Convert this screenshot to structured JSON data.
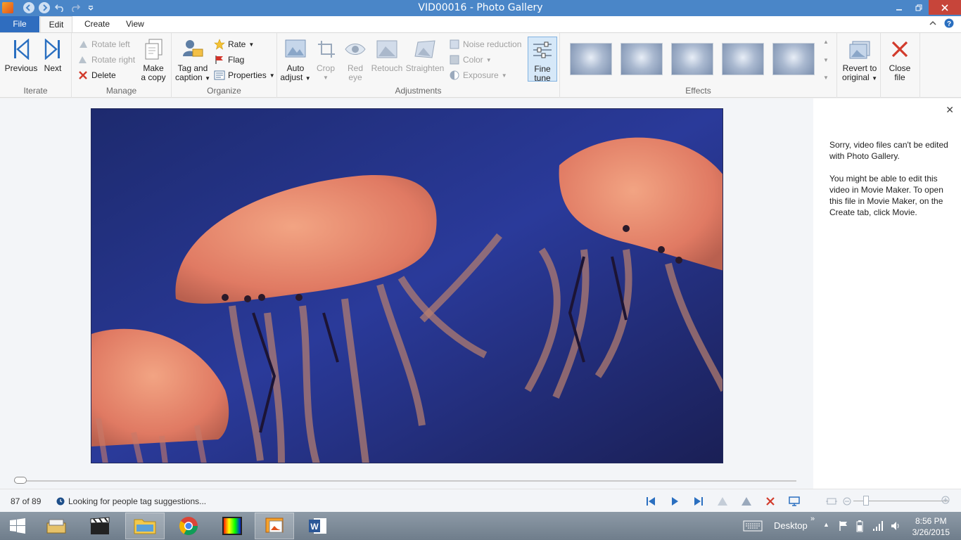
{
  "window": {
    "title": "VID00016 - Photo Gallery"
  },
  "tabs": [
    {
      "label": "File"
    },
    {
      "label": "Edit"
    },
    {
      "label": "Create"
    },
    {
      "label": "View"
    }
  ],
  "ribbon": {
    "iterate": {
      "label": "Iterate",
      "previous": "Previous",
      "next": "Next"
    },
    "manage": {
      "label": "Manage",
      "rotate_left": "Rotate left",
      "rotate_right": "Rotate right",
      "delete": "Delete",
      "make_copy_1": "Make",
      "make_copy_2": "a copy"
    },
    "organize": {
      "label": "Organize",
      "tag_caption_1": "Tag and",
      "tag_caption_2": "caption",
      "rate": "Rate",
      "flag": "Flag",
      "properties": "Properties"
    },
    "adjustments": {
      "label": "Adjustments",
      "auto_adjust_1": "Auto",
      "auto_adjust_2": "adjust",
      "crop": "Crop",
      "red_eye_1": "Red",
      "red_eye_2": "eye",
      "retouch": "Retouch",
      "straighten": "Straighten",
      "noise_reduction": "Noise reduction",
      "color": "Color",
      "exposure": "Exposure",
      "fine_tune_1": "Fine",
      "fine_tune_2": "tune"
    },
    "effects": {
      "label": "Effects"
    },
    "revert": {
      "line1": "Revert to",
      "line2": "original"
    },
    "close": {
      "line1": "Close",
      "line2": "file"
    }
  },
  "info_pane": {
    "para1": "Sorry, video files can't be edited with Photo Gallery.",
    "para2": "You might be able to edit this video in Movie Maker. To open this file in Movie Maker, on the Create tab, click Movie."
  },
  "statusbar": {
    "count": "87 of 89",
    "status": "Looking for people tag suggestions..."
  },
  "taskbar": {
    "desktop": "Desktop",
    "time": "8:56 PM",
    "date": "3/26/2015"
  },
  "colors": {
    "titlebar": "#4a86c8",
    "file_tab": "#2f6dbf",
    "close_red": "#c7453a",
    "accent_blue": "#2a6fc0"
  }
}
